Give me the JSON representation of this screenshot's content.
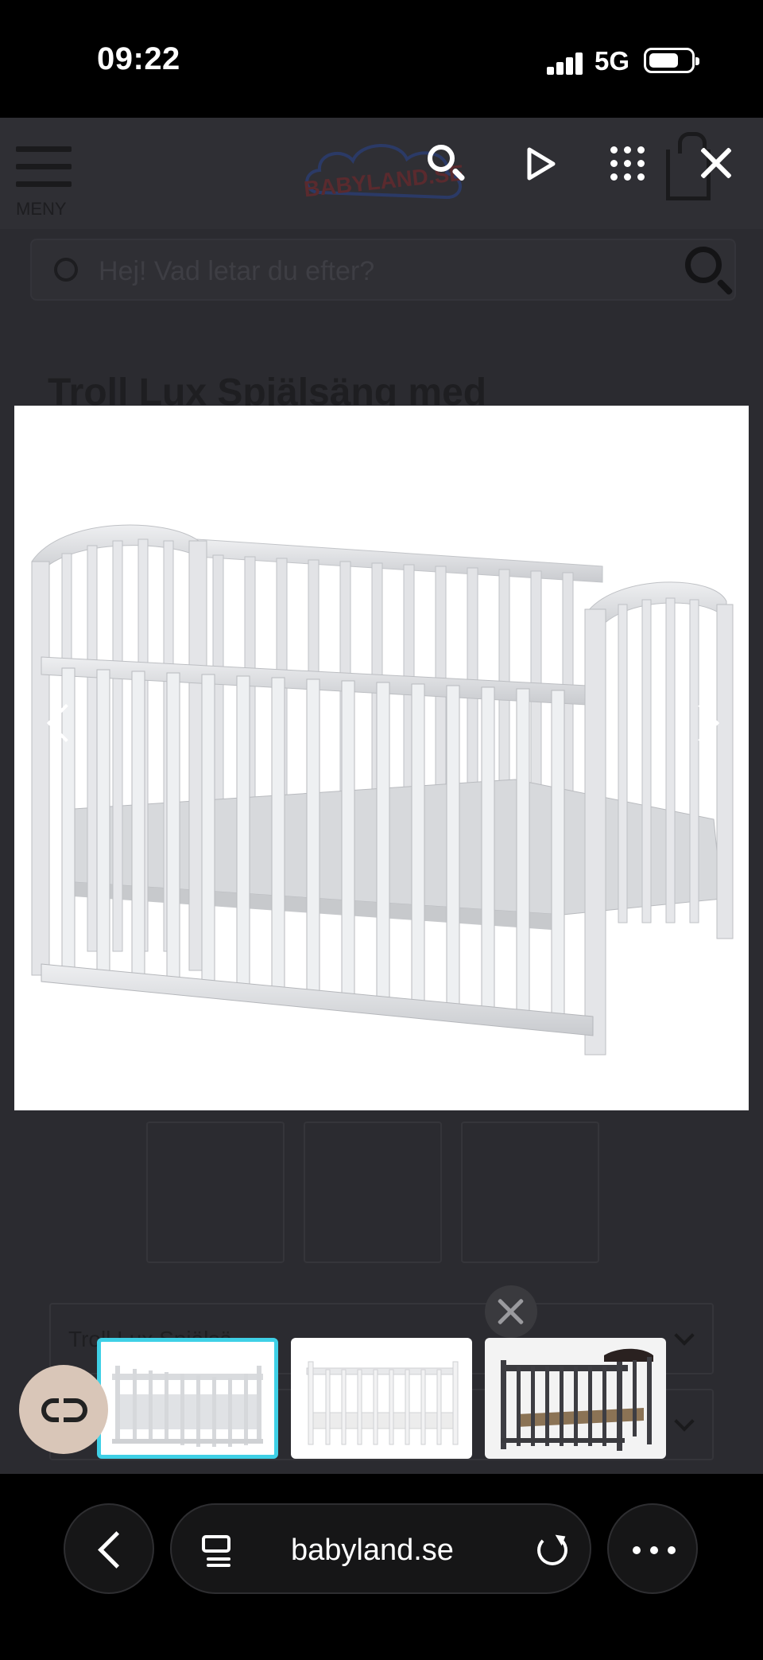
{
  "status_bar": {
    "time": "09:22",
    "network": "5G"
  },
  "page": {
    "menu_label": "MENY",
    "logo_text": "BABYLAND.SE",
    "search_placeholder": "Hej! Vad letar du efter?",
    "product_title": "Troll Lux Spjälsäng med",
    "variant_select_text": "Troll Lux Spjälsä"
  },
  "gallery": {
    "thumbnails": [
      {
        "label": "grey crib",
        "active": true
      },
      {
        "label": "white crib",
        "active": false
      },
      {
        "label": "dark grey crib",
        "active": false
      }
    ],
    "colors": {
      "active_border": "#3fd0e6"
    }
  },
  "browser": {
    "url": "babyland.se"
  },
  "icons": {
    "search": "search-icon",
    "play": "play-icon",
    "grid": "grid-icon",
    "close": "close-icon",
    "prev": "chevron-left-icon",
    "next": "chevron-right-icon",
    "chat": "link-icon",
    "back": "chevron-left-icon",
    "reader": "reader-icon",
    "reload": "reload-icon",
    "more": "more-icon"
  }
}
